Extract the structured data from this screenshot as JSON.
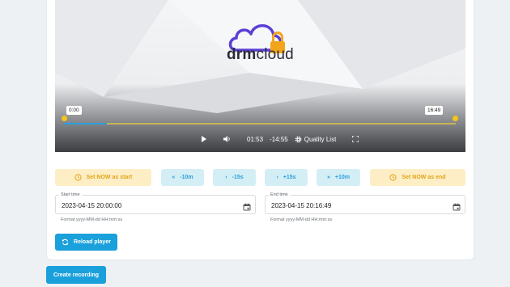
{
  "player": {
    "logo_bold": "drm",
    "logo_light": "cloud",
    "start_badge": "0:00",
    "end_badge": "16:49",
    "current_time": "01:53",
    "remaining_time": "-14:55",
    "quality_label": "Quality List",
    "progress_fraction": 0.11
  },
  "actions": {
    "set_now_start": "Set NOW as start",
    "rewind_10m": "-10m",
    "rewind_15s": "-15s",
    "forward_15s": "+15s",
    "forward_10m": "+10m",
    "set_now_end": "Set NOW as end"
  },
  "form": {
    "start_label": "Start time",
    "start_value": "2023-04-15 20:00:00",
    "start_hint": "Format yyyy-MM-dd HH:mm:ss",
    "end_label": "End time",
    "end_value": "2023-04-15 20:16:49",
    "end_hint": "Format yyyy-MM-dd HH:mm:ss"
  },
  "buttons": {
    "reload": "Reload player",
    "create": "Create recording"
  },
  "colors": {
    "accent_blue": "#1aa0db",
    "accent_yellow": "#e0a417",
    "marker_yellow": "#f5c518",
    "logo_purple": "#5b3fd6",
    "lock_orange": "#f2a51c"
  }
}
